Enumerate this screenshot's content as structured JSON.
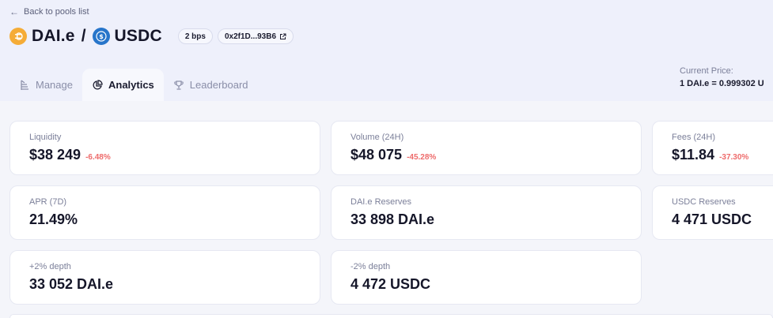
{
  "header": {
    "back_label": "Back to pools list",
    "token_a": "DAI.e",
    "separator": "/",
    "token_b": "USDC",
    "fee_badge": "2 bps",
    "address_badge": "0x2f1D...93B6"
  },
  "tabs": [
    {
      "label": "Manage",
      "icon": "manage-icon"
    },
    {
      "label": "Analytics",
      "icon": "analytics-icon"
    },
    {
      "label": "Leaderboard",
      "icon": "trophy-icon"
    }
  ],
  "current_price": {
    "label": "Current Price:",
    "value": "1 DAI.e = 0.999302 U"
  },
  "cards": {
    "liquidity": {
      "label": "Liquidity",
      "value": "$38 249",
      "change": "-6.48%"
    },
    "volume": {
      "label": "Volume (24H)",
      "value": "$48 075",
      "change": "-45.28%"
    },
    "fees": {
      "label": "Fees (24H)",
      "value": "$11.84",
      "change": "-37.30%"
    },
    "apr": {
      "label": "APR (7D)",
      "value": "21.49%"
    },
    "dai_reserves": {
      "label": "DAI.e Reserves",
      "value": "33 898 DAI.e"
    },
    "usdc_reserves": {
      "label": "USDC Reserves",
      "value": "4 471 USDC"
    },
    "plus_depth": {
      "label": "+2% depth",
      "value": "33 052 DAI.e"
    },
    "minus_depth": {
      "label": "-2% depth",
      "value": "4 472 USDC"
    }
  },
  "colors": {
    "accent_negative": "#ee6b6b",
    "dai": "#f5ac37",
    "usdc": "#2775ca"
  }
}
